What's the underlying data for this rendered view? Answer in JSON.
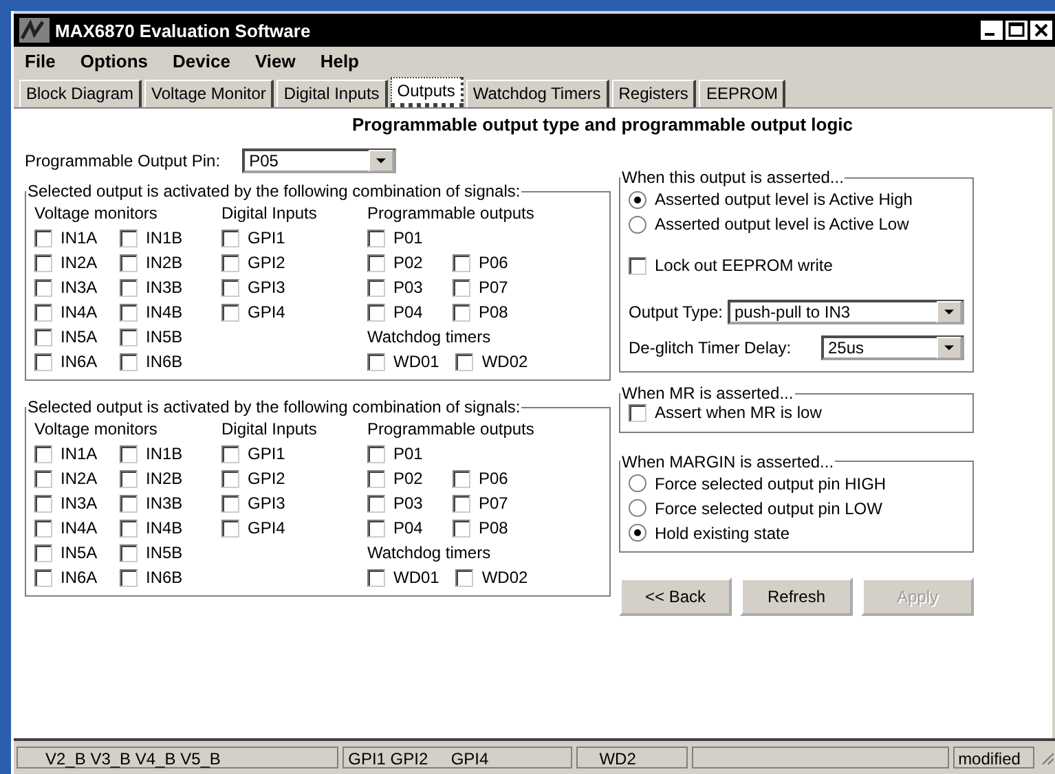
{
  "window": {
    "title": "MAX6870 Evaluation Software"
  },
  "menu": [
    "File",
    "Options",
    "Device",
    "View",
    "Help"
  ],
  "tabs": [
    {
      "label": "Block Diagram",
      "selected": false
    },
    {
      "label": "Voltage Monitor",
      "selected": false
    },
    {
      "label": "Digital Inputs",
      "selected": false
    },
    {
      "label": "Outputs",
      "selected": true
    },
    {
      "label": "Watchdog Timers",
      "selected": false
    },
    {
      "label": "Registers",
      "selected": false
    },
    {
      "label": "EEPROM",
      "selected": false
    }
  ],
  "heading": "Programmable output type and programmable output logic",
  "pin": {
    "label": "Programmable Output Pin:",
    "value": "P05"
  },
  "signal_groups": [
    {
      "title": "Selected output is activated by the following combination of signals:",
      "columns": [
        [
          {
            "heading": "Voltage monitors",
            "rows": [
              [
                {
                  "label": "IN1A",
                  "checked": false
                },
                {
                  "label": "IN1B",
                  "checked": false
                }
              ],
              [
                {
                  "label": "IN2A",
                  "checked": false
                },
                {
                  "label": "IN2B",
                  "checked": false
                }
              ],
              [
                {
                  "label": "IN3A",
                  "checked": false
                },
                {
                  "label": "IN3B",
                  "checked": false
                }
              ],
              [
                {
                  "label": "IN4A",
                  "checked": false
                },
                {
                  "label": "IN4B",
                  "checked": false
                }
              ],
              [
                {
                  "label": "IN5A",
                  "checked": false
                },
                {
                  "label": "IN5B",
                  "checked": false
                }
              ],
              [
                {
                  "label": "IN6A",
                  "checked": false
                },
                {
                  "label": "IN6B",
                  "checked": false
                }
              ]
            ]
          }
        ],
        [
          {
            "heading": "Digital Inputs",
            "rows": [
              [
                {
                  "label": "GPI1",
                  "checked": false
                }
              ],
              [
                {
                  "label": "GPI2",
                  "checked": false
                }
              ],
              [
                {
                  "label": "GPI3",
                  "checked": false
                }
              ],
              [
                {
                  "label": "GPI4",
                  "checked": false
                }
              ]
            ]
          }
        ],
        [
          {
            "heading": "Programmable outputs",
            "rows": [
              [
                {
                  "label": "P01",
                  "checked": false
                }
              ],
              [
                {
                  "label": "P02",
                  "checked": false
                },
                {
                  "label": "P06",
                  "checked": false
                }
              ],
              [
                {
                  "label": "P03",
                  "checked": false
                },
                {
                  "label": "P07",
                  "checked": false
                }
              ],
              [
                {
                  "label": "P04",
                  "checked": false
                },
                {
                  "label": "P08",
                  "checked": false
                }
              ]
            ]
          },
          {
            "heading": "Watchdog timers",
            "rows": [
              [
                {
                  "label": "WD01",
                  "checked": false
                },
                {
                  "label": "WD02",
                  "checked": false
                }
              ]
            ]
          }
        ]
      ]
    },
    {
      "title": "Selected output is activated by the following combination of signals:",
      "columns": [
        [
          {
            "heading": "Voltage monitors",
            "rows": [
              [
                {
                  "label": "IN1A",
                  "checked": false
                },
                {
                  "label": "IN1B",
                  "checked": false
                }
              ],
              [
                {
                  "label": "IN2A",
                  "checked": false
                },
                {
                  "label": "IN2B",
                  "checked": false
                }
              ],
              [
                {
                  "label": "IN3A",
                  "checked": false
                },
                {
                  "label": "IN3B",
                  "checked": false
                }
              ],
              [
                {
                  "label": "IN4A",
                  "checked": false
                },
                {
                  "label": "IN4B",
                  "checked": false
                }
              ],
              [
                {
                  "label": "IN5A",
                  "checked": false
                },
                {
                  "label": "IN5B",
                  "checked": false
                }
              ],
              [
                {
                  "label": "IN6A",
                  "checked": false
                },
                {
                  "label": "IN6B",
                  "checked": false
                }
              ]
            ]
          }
        ],
        [
          {
            "heading": "Digital Inputs",
            "rows": [
              [
                {
                  "label": "GPI1",
                  "checked": false
                }
              ],
              [
                {
                  "label": "GPI2",
                  "checked": false
                }
              ],
              [
                {
                  "label": "GPI3",
                  "checked": false
                }
              ],
              [
                {
                  "label": "GPI4",
                  "checked": false
                }
              ]
            ]
          }
        ],
        [
          {
            "heading": "Programmable outputs",
            "rows": [
              [
                {
                  "label": "P01",
                  "checked": false
                }
              ],
              [
                {
                  "label": "P02",
                  "checked": false
                },
                {
                  "label": "P06",
                  "checked": false
                }
              ],
              [
                {
                  "label": "P03",
                  "checked": false
                },
                {
                  "label": "P07",
                  "checked": false
                }
              ],
              [
                {
                  "label": "P04",
                  "checked": false
                },
                {
                  "label": "P08",
                  "checked": false
                }
              ]
            ]
          },
          {
            "heading": "Watchdog timers",
            "rows": [
              [
                {
                  "label": "WD01",
                  "checked": false
                },
                {
                  "label": "WD02",
                  "checked": false
                }
              ]
            ]
          }
        ]
      ]
    }
  ],
  "asserted": {
    "title": "When this output is asserted...",
    "options": [
      {
        "label": "Asserted output level is Active High",
        "selected": true
      },
      {
        "label": "Asserted output level is Active Low",
        "selected": false
      }
    ],
    "lock": {
      "label": "Lock out EEPROM write",
      "checked": false
    },
    "output_type": {
      "label": "Output Type:",
      "value": "push-pull to IN3"
    },
    "deglitch": {
      "label": "De-glitch Timer Delay:",
      "value": "25us"
    }
  },
  "mr": {
    "title": "When MR is asserted...",
    "option": {
      "label": "Assert when MR is low",
      "checked": false
    }
  },
  "margin": {
    "title": "When MARGIN is asserted...",
    "options": [
      {
        "label": "Force selected output pin HIGH",
        "selected": false
      },
      {
        "label": "Force selected output pin LOW",
        "selected": false
      },
      {
        "label": "Hold existing state",
        "selected": true
      }
    ]
  },
  "buttons": [
    {
      "label": "<< Back",
      "disabled": false
    },
    {
      "label": "Refresh",
      "disabled": false
    },
    {
      "label": "Apply",
      "disabled": true
    }
  ],
  "status_bar": [
    "V2_B V3_B V4_B V5_B",
    "GPI1 GPI2     GPI4",
    "WD2",
    "modified"
  ]
}
